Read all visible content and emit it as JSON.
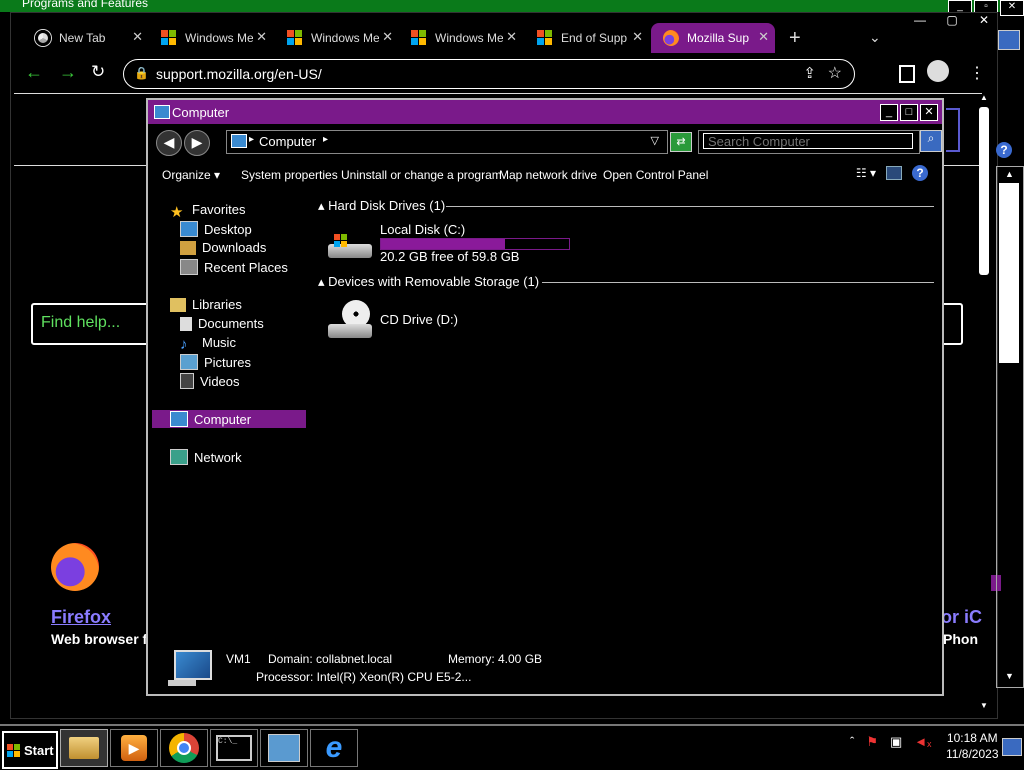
{
  "background_window": {
    "title": "Programs and Features"
  },
  "browser": {
    "tabs": [
      {
        "label": "New Tab",
        "icon": "chrome-icon",
        "active": false
      },
      {
        "label": "Windows Me",
        "icon": "windows-logo-icon",
        "active": false
      },
      {
        "label": "Windows Me",
        "icon": "windows-logo-icon",
        "active": false
      },
      {
        "label": "Windows Me",
        "icon": "windows-logo-icon",
        "active": false
      },
      {
        "label": "End of Supp",
        "icon": "windows-logo-icon",
        "active": false
      },
      {
        "label": "Mozilla Supp",
        "icon": "firefox-icon",
        "active": true
      }
    ],
    "url": "support.mozilla.org/en-US/",
    "page": {
      "search_placeholder": "Find help...",
      "product_firefox_name": "Firefox",
      "product_firefox_desc": "Web browser f",
      "product_ios_name": "or iC",
      "product_ios_desc": "Phon"
    }
  },
  "explorer": {
    "title": "Computer",
    "address": "Computer",
    "search_placeholder": "Search Computer",
    "commands": [
      "Organize",
      "System properties",
      "Uninstall or change a program",
      "Map network drive",
      "Open Control Panel"
    ],
    "nav": {
      "favorites": {
        "label": "Favorites",
        "items": [
          "Desktop",
          "Downloads",
          "Recent Places"
        ]
      },
      "libraries": {
        "label": "Libraries",
        "items": [
          "Documents",
          "Music",
          "Pictures",
          "Videos"
        ]
      },
      "computer": "Computer",
      "network": "Network"
    },
    "groups": {
      "hdd": {
        "header": "Hard Disk Drives (1)",
        "drive": {
          "name": "Local Disk (C:)",
          "free_text": "20.2 GB free of 59.8 GB",
          "used_fraction": 0.662
        }
      },
      "removable": {
        "header": "Devices with Removable Storage (1)",
        "drive": {
          "name": "CD Drive (D:)"
        }
      }
    },
    "details": {
      "name": "VM1",
      "domain": "Domain: collabnet.local",
      "memory": "Memory: 4.00 GB",
      "processor": "Processor: Intel(R) Xeon(R) CPU E5-2..."
    }
  },
  "taskbar": {
    "start_label": "Start",
    "items": [
      "explorer-icon",
      "media-player-icon",
      "chrome-icon",
      "cmd-icon",
      "server-manager-icon",
      "internet-explorer-icon"
    ],
    "clock_time": "10:18 AM",
    "clock_date": "11/8/2023"
  },
  "colors": {
    "accent": "#7a1a8a",
    "link": "#8a7cff",
    "search_green": "#5fe05f"
  }
}
